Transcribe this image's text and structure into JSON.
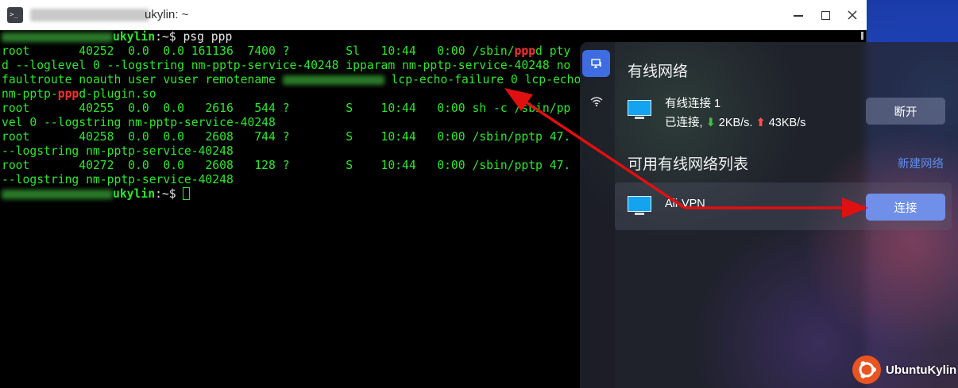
{
  "terminal": {
    "title": "ukylin: ~",
    "prompt_host": "ukylin",
    "prompt_suffix": ":~$ ",
    "command": "psg ppp",
    "lines": {
      "l1_a": "root       40252  0.0  0.0 161136  7400 ?        Sl   10:44   0:00 /sbin/",
      "l1_hl": "ppp",
      "l1_b": "d pty",
      "l2": "d --loglevel 0 --logstring nm-pptp-service-40248 ipparam nm-pptp-service-40248 no",
      "l3_a": "faultroute noauth user vuser remotename ",
      "l3_b": " lcp-echo-failure 0 lcp-echo",
      "l4_a": "nm-pptp-",
      "l4_hl": "ppp",
      "l4_b": "d-plugin.so",
      "l5": "root       40255  0.0  0.0   2616   544 ?        S    10:44   0:00 sh -c /sbin/pp",
      "l6": "vel 0 --logstring nm-pptp-service-40248",
      "l7": "root       40258  0.0  0.0   2608   744 ?        S    10:44   0:00 /sbin/pptp 47.",
      "l8": "--logstring nm-pptp-service-40248",
      "l9": "root       40272  0.0  0.0   2608   128 ?        S    10:44   0:00 /sbin/pptp 47.",
      "l10": "--logstring nm-pptp-service-40248"
    }
  },
  "network_panel": {
    "wired_title": "有线网络",
    "connection": {
      "name": "有线连接 1",
      "status_prefix": "已连接,",
      "down_arrow": "⬇",
      "down_rate": "2KB/s.",
      "up_arrow": "⬆",
      "up_rate": "43KB/s",
      "disconnect_label": "断开"
    },
    "available_title": "可用有线网络列表",
    "new_network_label": "新建网络",
    "available": [
      {
        "name": "Ali-VPN",
        "connect_label": "连接"
      }
    ],
    "side_icons": [
      "wired-network-icon",
      "wifi-icon"
    ]
  },
  "watermark": {
    "text": "UbuntuKylin"
  },
  "colors": {
    "terminal_text": "#2ee62e",
    "terminal_highlight": "#ff3030",
    "panel_accent": "#3d6de0",
    "connect_button": "#6f8fe8",
    "link": "#5d8ff0",
    "annotation_arrow": "#e01010"
  }
}
